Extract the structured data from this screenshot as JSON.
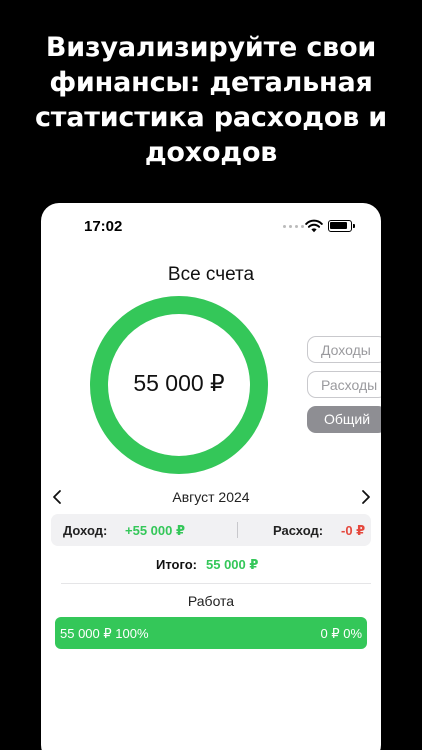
{
  "promo": {
    "line1": "Визуализируйте свои",
    "line2": "финансы: детальная",
    "line3": "статистика расходов и",
    "line4": "доходов"
  },
  "statusbar": {
    "time": "17:02"
  },
  "colors": {
    "accent_green": "#34C759",
    "expense_red": "#E5483D",
    "segment_active": "#8E8E93"
  },
  "account": {
    "title": "Все счета",
    "balance": "55 000 ₽"
  },
  "ring": {
    "income_fraction": 1.0
  },
  "segments": [
    {
      "label": "Доходы",
      "selected": false
    },
    {
      "label": "Расходы",
      "selected": false
    },
    {
      "label": "Общий",
      "selected": true
    }
  ],
  "period": {
    "label": "Август 2024",
    "prev_icon": "chevron-left-icon",
    "next_icon": "chevron-right-icon"
  },
  "summary": {
    "income_label": "Доход:",
    "income_value": "+55 000 ₽",
    "separator": "|",
    "expense_label": "Расход:",
    "expense_value": "-0 ₽"
  },
  "total": {
    "label": "Итого:",
    "value": "55 000 ₽"
  },
  "category": {
    "title": "Работа",
    "left_text": "55 000 ₽ 100%",
    "right_text": "0 ₽ 0%",
    "income_share": 1.0
  }
}
